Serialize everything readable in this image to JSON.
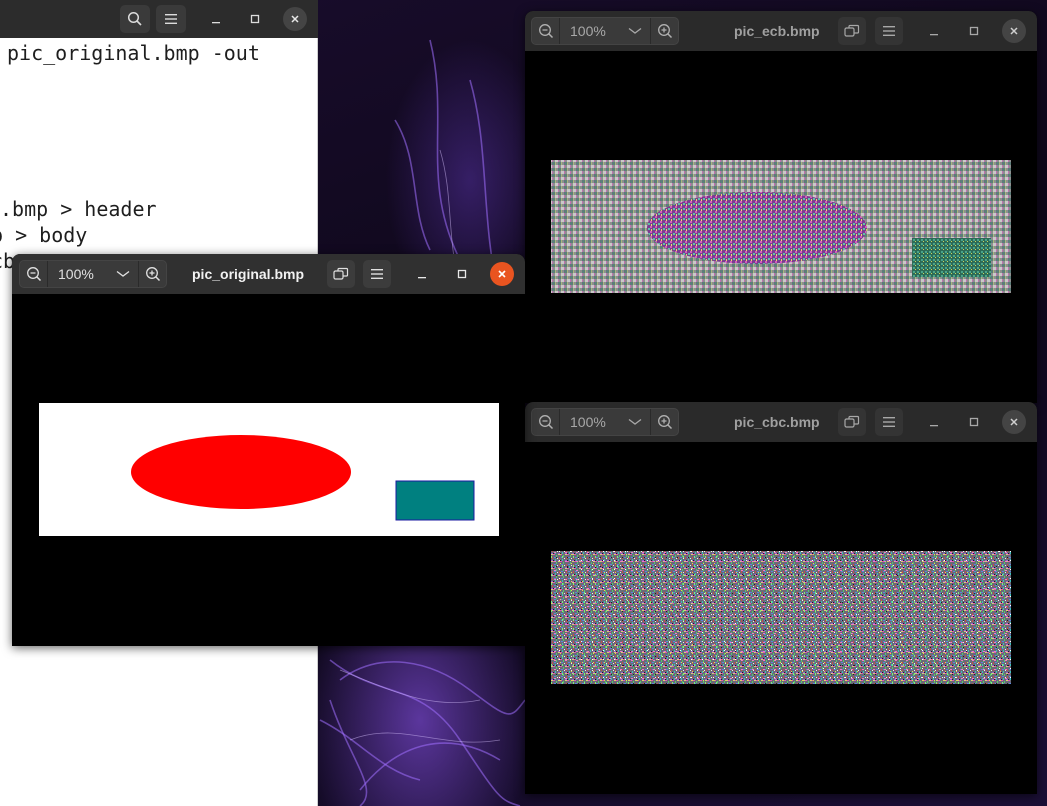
{
  "terminal": {
    "lines": [
      "pic_original.bmp -out",
      ".bmp > header",
      "p > body",
      "cb"
    ]
  },
  "windows": {
    "ecb": {
      "title": "pic_ecb.bmp",
      "zoom": "100%"
    },
    "cbc": {
      "title": "pic_cbc.bmp",
      "zoom": "100%"
    },
    "original": {
      "title": "pic_original.bmp",
      "zoom": "100%"
    }
  },
  "colors": {
    "ellipse": "#ff0000",
    "rect": "#008080",
    "close_active": "#e95420"
  },
  "icons": {
    "zoom_out": "zoom-out-icon",
    "zoom_in": "zoom-in-icon",
    "dropdown": "chevron-down-icon",
    "restore": "restore-icon",
    "menu": "hamburger-icon",
    "minimize": "minimize-icon",
    "maximize": "maximize-icon",
    "close": "close-icon",
    "search": "search-icon"
  }
}
